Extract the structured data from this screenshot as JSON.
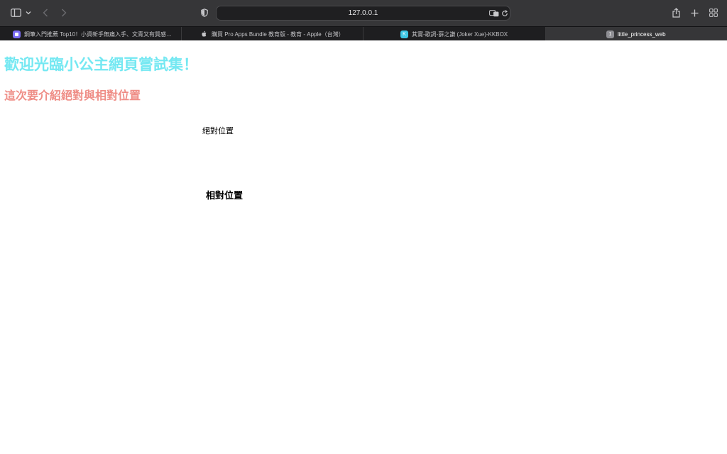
{
  "browser": {
    "address": "127.0.0.1",
    "tabs": [
      {
        "title": "鋼筆入門推薦 Top10！小資新手無痛入手、文青又有質感…",
        "favicon": "note-favicon",
        "favicon_color": "#7b6cf6",
        "favicon_glyph": "",
        "active": false
      },
      {
        "title": "購買 Pro Apps Bundle 教育版 - 教育 - Apple（台灣）",
        "favicon": "apple-logo",
        "favicon_color": "#c4c4c7",
        "favicon_glyph": "",
        "active": false
      },
      {
        "title": "其實-歌詞-薛之謙 (Joker Xue)-KKBOX",
        "favicon": "kkbox-favicon",
        "favicon_color": "#3ec8e6",
        "favicon_glyph": "K",
        "active": false
      },
      {
        "title": "little_princess_web",
        "favicon": "tab-number-badge",
        "favicon_color": "#8e8e93",
        "favicon_glyph": "1",
        "active": true
      }
    ]
  },
  "page": {
    "heading": "歡迎光臨小公主網頁嘗試集！",
    "subheading": "這次要介紹絕對與相對位置",
    "absolute_label": "絕對位置",
    "relative_label": "相對位置"
  },
  "colors": {
    "heading": "#74e8f2",
    "subheading": "#ef8d86"
  }
}
